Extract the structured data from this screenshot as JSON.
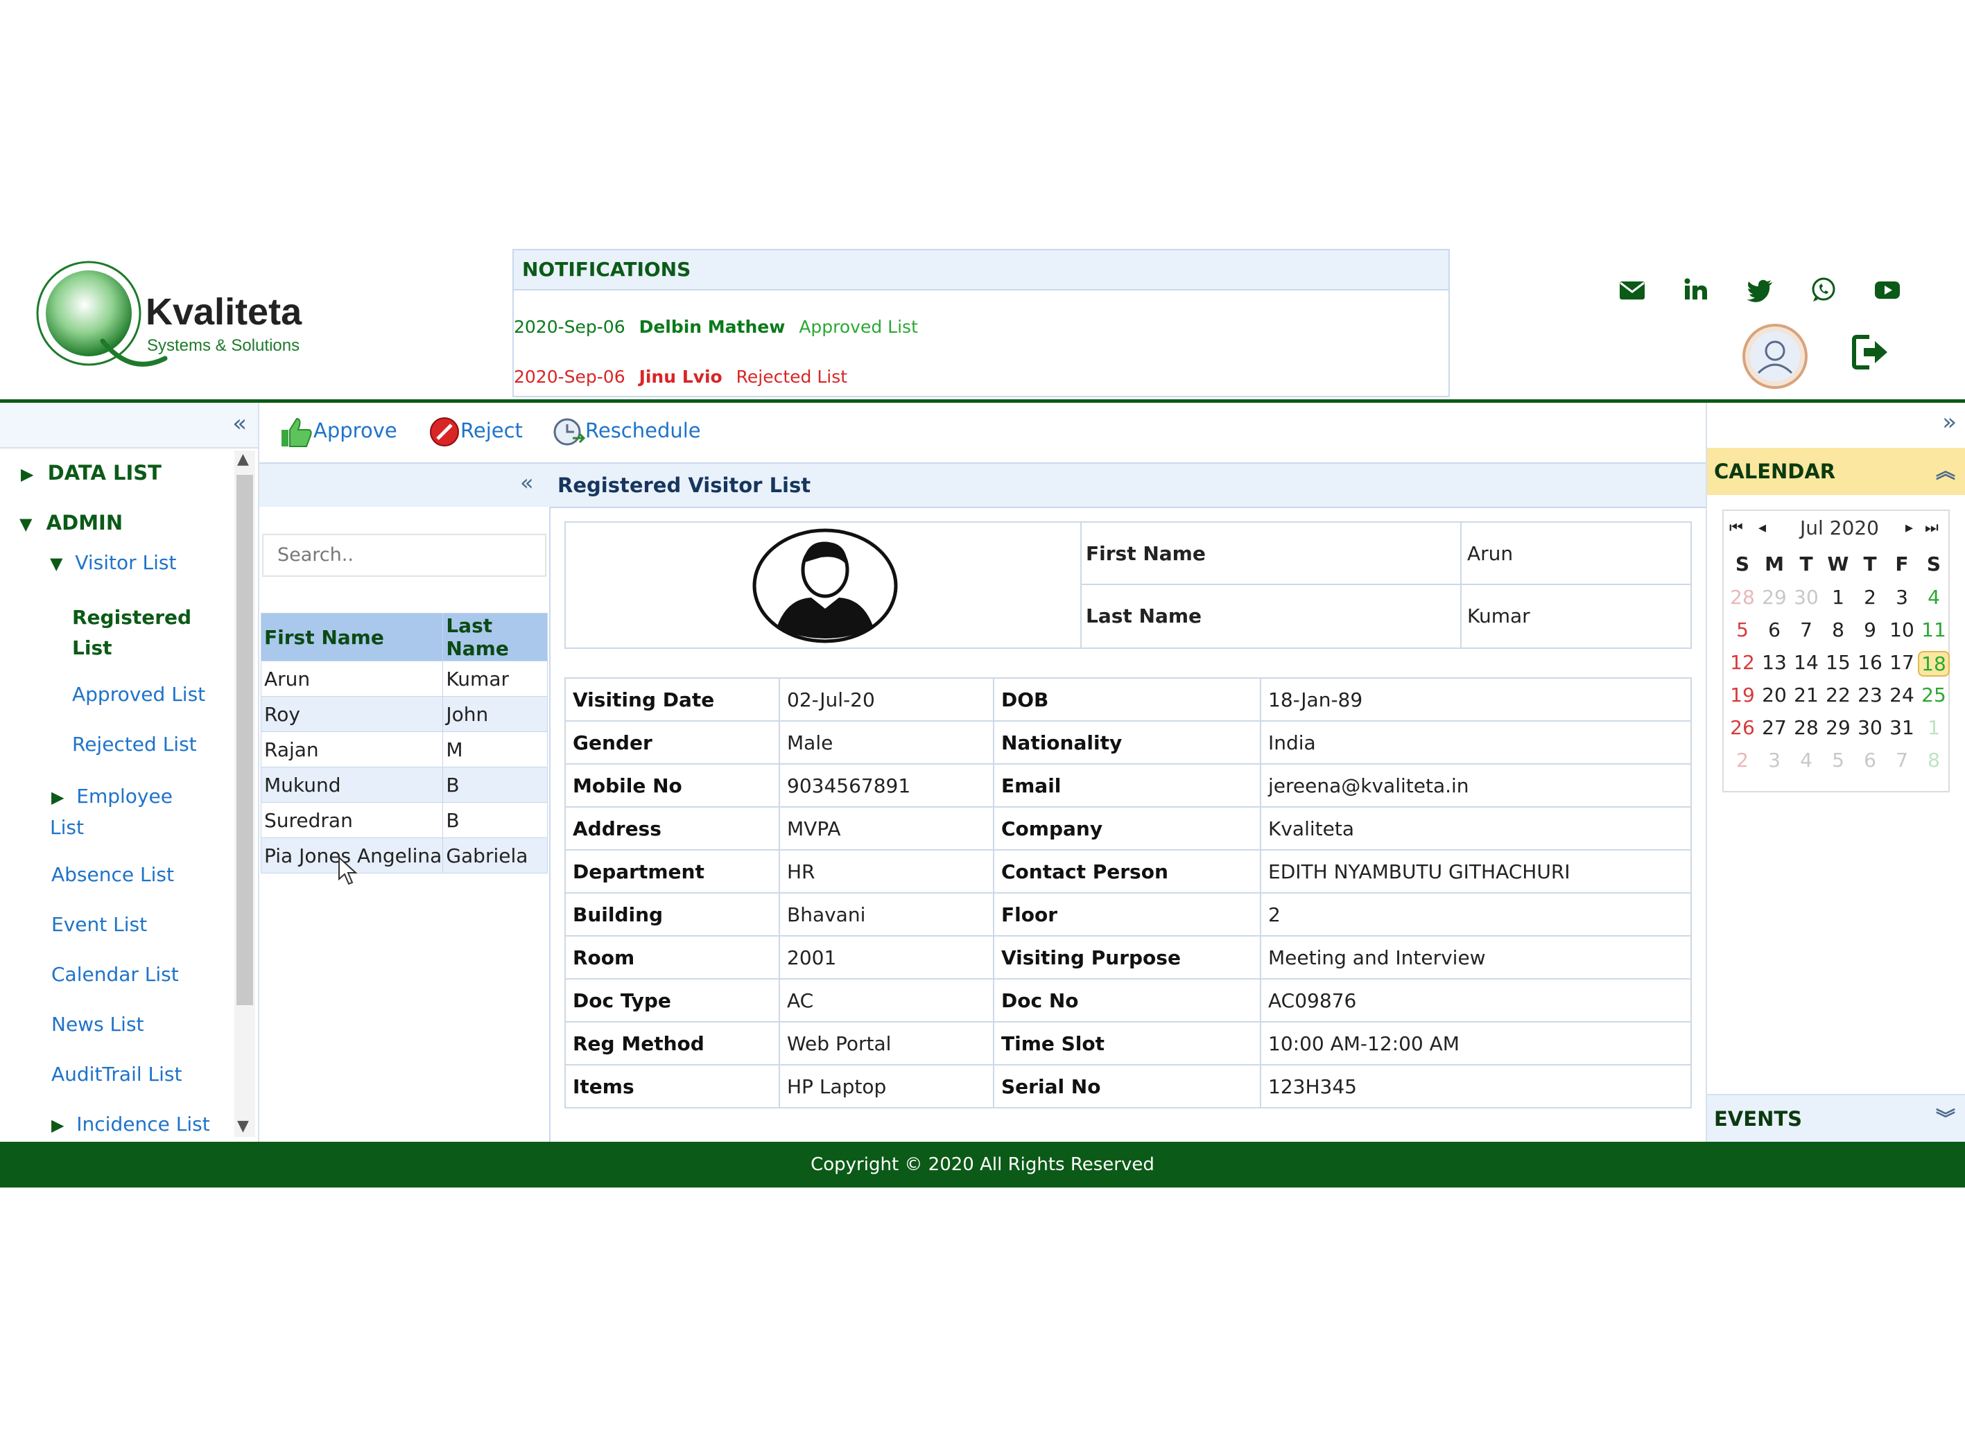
{
  "brand": {
    "name": "Kvaliteta",
    "tagline": "Systems & Solutions",
    "color": "#0b5a17"
  },
  "notifications": {
    "title": "NOTIFICATIONS",
    "items": [
      {
        "date": "2020-Sep-06",
        "name": "Delbin Mathew",
        "action": "Approved List",
        "color": "#0b7a1a"
      },
      {
        "date": "2020-Sep-06",
        "name": "Jinu Lvio",
        "action": "Rejected List",
        "color": "#d92525"
      }
    ]
  },
  "header_icons": [
    "mail-icon",
    "linkedin-icon",
    "twitter-icon",
    "whatsapp-icon",
    "youtube-icon",
    "profile-avatar",
    "logout-icon"
  ],
  "sidebar": {
    "collapse": "«",
    "data_list": "DATA LIST",
    "admin": "ADMIN",
    "visitor_list": "Visitor List",
    "registered_1": "Registered",
    "registered_2": "List",
    "approved": "Approved List",
    "rejected": "Rejected List",
    "employee_1": "Employee",
    "employee_2": "List",
    "absence": "Absence List",
    "event": "Event List",
    "calendar": "Calendar List",
    "news": "News List",
    "audit": "AuditTrail List",
    "incidence": "Incidence List"
  },
  "toolbar": {
    "approve": "Approve",
    "reject": "Reject",
    "reschedule": "Reschedule"
  },
  "panel": {
    "collapse": "«",
    "title": "Registered Visitor List"
  },
  "search": {
    "placeholder": "Search.."
  },
  "visitor_table": {
    "headers": [
      "First Name",
      "Last Name"
    ],
    "rows": [
      [
        "Arun",
        "Kumar"
      ],
      [
        "Roy",
        "John"
      ],
      [
        "Rajan",
        "M"
      ],
      [
        "Mukund",
        "B"
      ],
      [
        "Suredran",
        "B"
      ],
      [
        "Pia Jones Angelina",
        "Gabriela"
      ]
    ]
  },
  "detail": {
    "first_name_label": "First Name",
    "first_name": "Arun",
    "last_name_label": "Last Name",
    "last_name": "Kumar",
    "rows": [
      [
        "Visiting Date",
        "02-Jul-20",
        "DOB",
        "18-Jan-89"
      ],
      [
        "Gender",
        "Male",
        "Nationality",
        "India"
      ],
      [
        "Mobile No",
        "9034567891",
        "Email",
        "jereena@kvaliteta.in"
      ],
      [
        "Address",
        "MVPA",
        "Company",
        "Kvaliteta"
      ],
      [
        "Department",
        "HR",
        "Contact Person",
        "EDITH NYAMBUTU GITHACHURI"
      ],
      [
        "Building",
        "Bhavani",
        "Floor",
        "2"
      ],
      [
        "Room",
        "2001",
        "Visiting Purpose",
        "Meeting and Interview"
      ],
      [
        "Doc Type",
        "AC",
        "Doc No",
        "AC09876"
      ],
      [
        "Reg Method",
        "Web Portal",
        "Time Slot",
        "10:00 AM-12:00 AM"
      ],
      [
        "Items",
        "HP Laptop",
        "Serial No",
        "123H345"
      ]
    ]
  },
  "right_panel": {
    "expand": "»",
    "calendar_title": "CALENDAR",
    "events_title": "EVENTS"
  },
  "calendar": {
    "month": "Jul 2020",
    "weekdays": [
      "S",
      "M",
      "T",
      "W",
      "T",
      "F",
      "S"
    ],
    "weeks": [
      [
        "28",
        "29",
        "30",
        "1",
        "2",
        "3",
        "4"
      ],
      [
        "5",
        "6",
        "7",
        "8",
        "9",
        "10",
        "11"
      ],
      [
        "12",
        "13",
        "14",
        "15",
        "16",
        "17",
        "18"
      ],
      [
        "19",
        "20",
        "21",
        "22",
        "23",
        "24",
        "25"
      ],
      [
        "26",
        "27",
        "28",
        "29",
        "30",
        "31",
        "1"
      ],
      [
        "2",
        "3",
        "4",
        "5",
        "6",
        "7",
        "8"
      ]
    ],
    "today": "18",
    "today_bg": "#fbe7a0"
  },
  "footer": {
    "text": "Copyright © 2020 All Rights Reserved"
  }
}
